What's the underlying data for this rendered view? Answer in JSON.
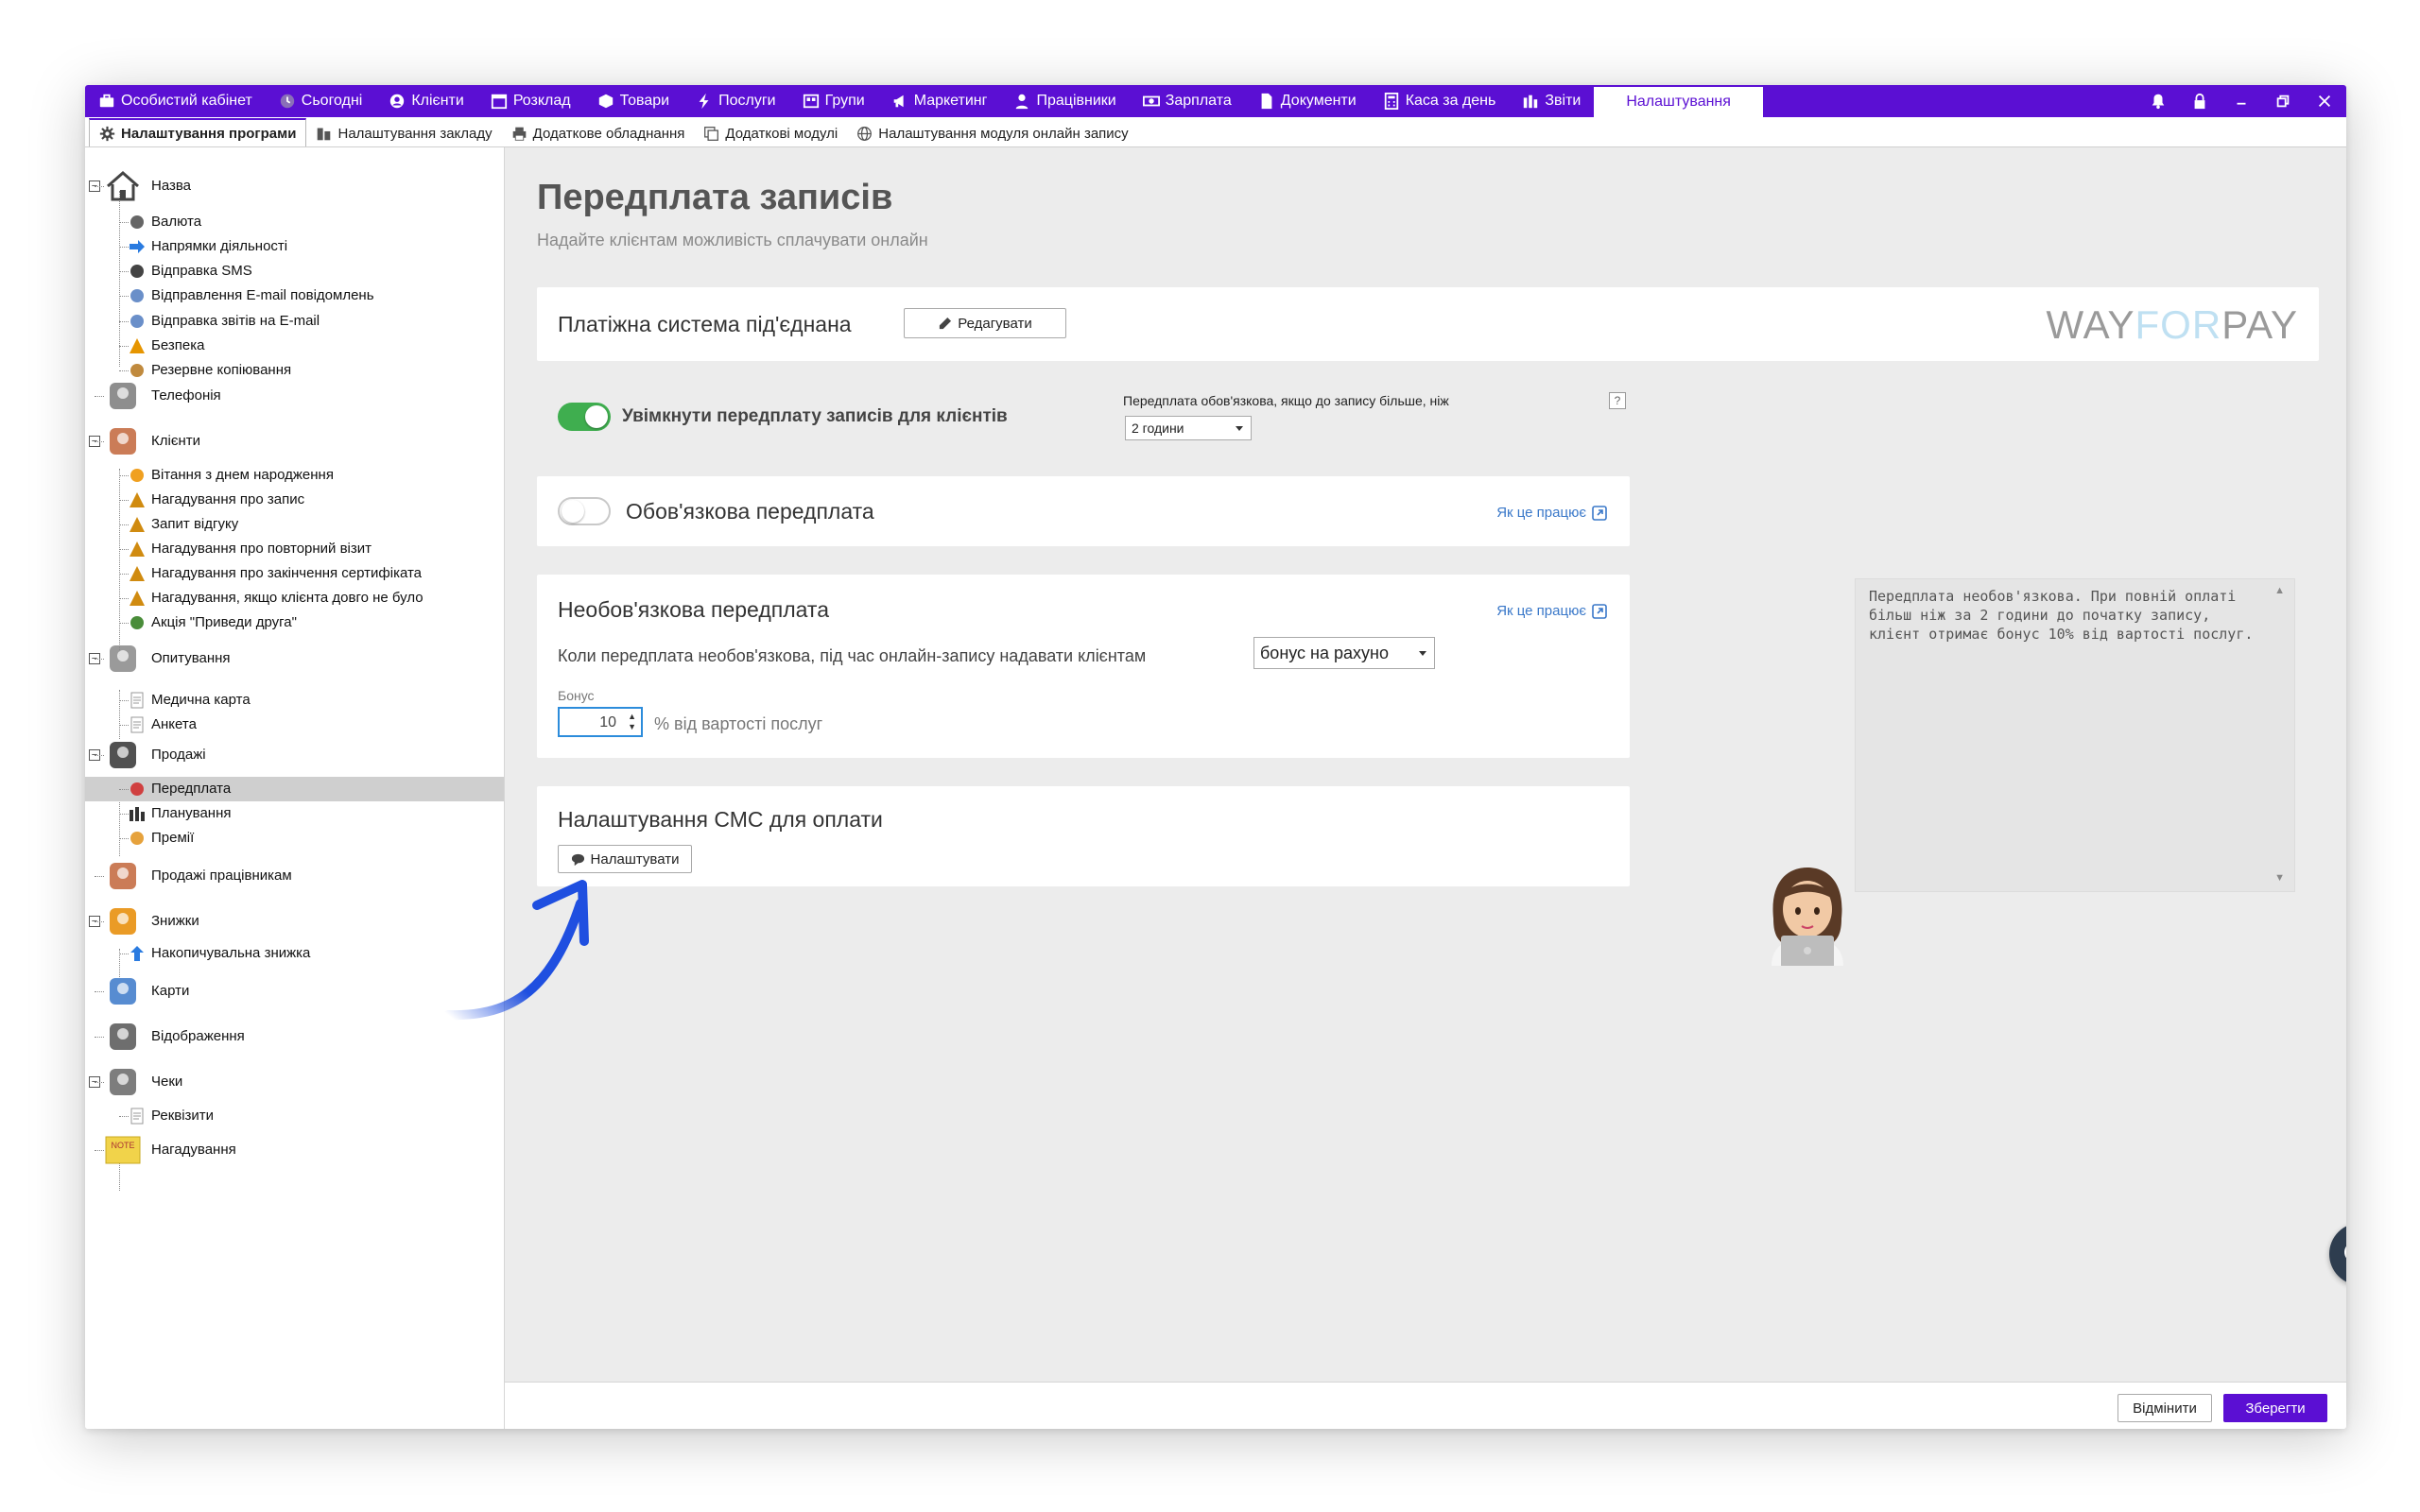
{
  "nav": {
    "items": [
      {
        "label": "Особистий кабінет",
        "icon": "briefcase-icon"
      },
      {
        "label": "Сьогодні",
        "icon": "clock-icon"
      },
      {
        "label": "Клієнти",
        "icon": "user-circle-icon"
      },
      {
        "label": "Розклад",
        "icon": "calendar-icon"
      },
      {
        "label": "Товари",
        "icon": "box-icon"
      },
      {
        "label": "Послуги",
        "icon": "bolt-icon"
      },
      {
        "label": "Групи",
        "icon": "group-icon"
      },
      {
        "label": "Маркетинг",
        "icon": "megaphone-icon"
      },
      {
        "label": "Працівники",
        "icon": "person-icon"
      },
      {
        "label": "Зарплата",
        "icon": "money-icon"
      },
      {
        "label": "Документи",
        "icon": "document-icon"
      },
      {
        "label": "Каса за день",
        "icon": "calculator-icon"
      },
      {
        "label": "Звіти",
        "icon": "bar-chart-icon"
      }
    ],
    "active_label": "Налаштування"
  },
  "subtabs": [
    {
      "label": "Налаштування програми",
      "icon": "gear-icon",
      "active": true
    },
    {
      "label": "Налаштування закладу",
      "icon": "building-icon"
    },
    {
      "label": "Додаткове обладнання",
      "icon": "printer-icon"
    },
    {
      "label": "Додаткові модулі",
      "icon": "modules-icon"
    },
    {
      "label": "Налаштування модуля онлайн запису",
      "icon": "globe-icon"
    }
  ],
  "sidebar": {
    "items": [
      {
        "label": "Назва",
        "level": 0,
        "icon": "house-icon"
      },
      {
        "label": "Валюта",
        "level": 1,
        "icon": "cash-icon"
      },
      {
        "label": "Напрямки діяльності",
        "level": 1,
        "icon": "arrow-right-icon"
      },
      {
        "label": "Відправка SMS",
        "level": 1,
        "icon": "speech-bubble-icon"
      },
      {
        "label": "Відправлення E-mail повідомлень",
        "level": 1,
        "icon": "email-icon"
      },
      {
        "label": "Відправка звітів на E-mail",
        "level": 1,
        "icon": "email-icon"
      },
      {
        "label": "Безпека",
        "level": 1,
        "icon": "warning-icon"
      },
      {
        "label": "Резервне копіювання",
        "level": 1,
        "icon": "backup-icon"
      },
      {
        "label": "Телефонія",
        "level": 0,
        "icon": "phone-icon"
      },
      {
        "label": "Клієнти",
        "level": 0,
        "icon": "client-icon"
      },
      {
        "label": "Вітання з днем народження",
        "level": 1,
        "icon": "smile-icon"
      },
      {
        "label": "Нагадування про запис",
        "level": 1,
        "icon": "bell-icon"
      },
      {
        "label": "Запит відгуку",
        "level": 1,
        "icon": "bell-icon"
      },
      {
        "label": "Нагадування про повторний візит",
        "level": 1,
        "icon": "bell-icon"
      },
      {
        "label": "Нагадування про закінчення сертифіката",
        "level": 1,
        "icon": "bell-icon"
      },
      {
        "label": "Нагадування, якщо клієнта довго не було",
        "level": 1,
        "icon": "bell-icon"
      },
      {
        "label": "Акція \"Приведи друга\"",
        "level": 1,
        "icon": "friends-icon"
      },
      {
        "label": "Опитування",
        "level": 0,
        "icon": "survey-icon"
      },
      {
        "label": "Медична карта",
        "level": 1,
        "icon": "form-icon"
      },
      {
        "label": "Анкета",
        "level": 1,
        "icon": "form-icon"
      },
      {
        "label": "Продажі",
        "level": 0,
        "icon": "sales-icon"
      },
      {
        "label": "Передплата",
        "level": 1,
        "icon": "prepay-icon"
      },
      {
        "label": "Планування",
        "level": 1,
        "icon": "bar-chart-icon"
      },
      {
        "label": "Премії",
        "level": 1,
        "icon": "trophy-icon"
      },
      {
        "label": "Продажі працівникам",
        "level": 0,
        "icon": "employee-icon"
      },
      {
        "label": "Знижки",
        "level": 0,
        "icon": "discount-icon"
      },
      {
        "label": "Накопичувальна знижка",
        "level": 1,
        "icon": "arrow-up-icon"
      },
      {
        "label": "Карти",
        "level": 0,
        "icon": "card-icon"
      },
      {
        "label": "Відображення",
        "level": 0,
        "icon": "magnifier-icon"
      },
      {
        "label": "Чеки",
        "level": 0,
        "icon": "receipt-printer-icon"
      },
      {
        "label": "Реквізити",
        "level": 1,
        "icon": "form-icon"
      },
      {
        "label": "Нагадування",
        "level": 0,
        "icon": "note-icon"
      }
    ],
    "note_sticker_text": "NOTE"
  },
  "page": {
    "title": "Передплата записів",
    "subtitle": "Надайте клієнтам можливість сплачувати онлайн"
  },
  "payment": {
    "status": "Платіжна система під'єднана",
    "edit_button": "Редагувати",
    "logo_left": "WAY",
    "logo_mid": "FOR",
    "logo_right": "PAY"
  },
  "enable": {
    "label": "Увімкнути передплату записів для клієнтів",
    "on": true,
    "required_if_label": "Передплата обов'язкова, якщо до запису більше, ніж",
    "help": "?",
    "hours_value": "2 години"
  },
  "mandatory": {
    "label": "Обов'язкова передплата",
    "on": false,
    "how_link": "Як це працює"
  },
  "optional": {
    "title": "Необов'язкова передплата",
    "how_link": "Як це працює",
    "give_label": "Коли передплата необов'язкова, під час онлайн-запису надавати клієнтам",
    "give_value": "бонус на рахуно",
    "bonus_label": "Бонус",
    "bonus_value": "10",
    "bonus_suffix": "% від вартості послуг"
  },
  "sms": {
    "title": "Налаштування СМС для оплати",
    "button": "Налаштувати"
  },
  "hint": {
    "text": "Передплата необов'язкова. При повній оплаті більш ніж за 2 години до початку запису, клієнт отримає бонус 10% від вартості послуг."
  },
  "footer": {
    "cancel": "Відмінити",
    "save": "Зберегти"
  },
  "colors": {
    "accent": "#5b0fd3",
    "toggle_on": "#3fae4f",
    "link": "#3a78c9",
    "arrow": "#1f4fe0"
  }
}
